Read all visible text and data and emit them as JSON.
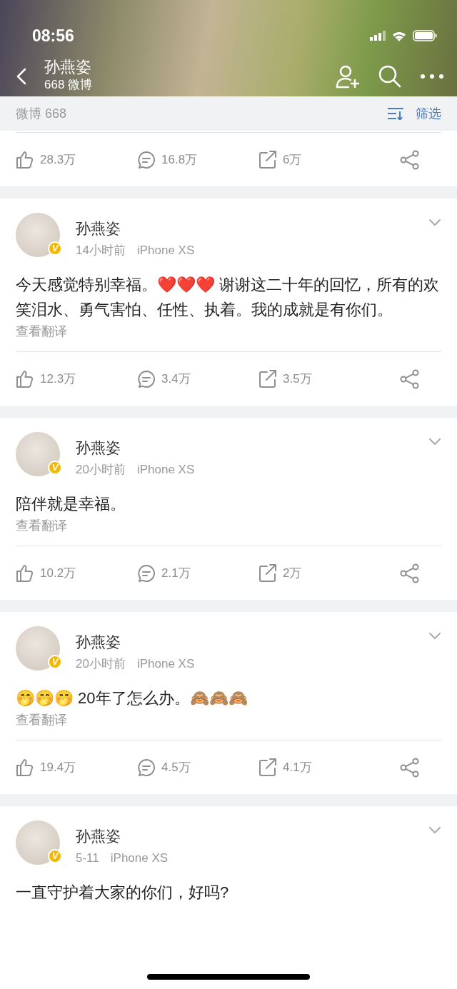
{
  "status_bar": {
    "time": "08:56"
  },
  "header": {
    "title": "孙燕姿",
    "subtitle": "668 微博"
  },
  "filter_bar": {
    "label": "微博 668",
    "filter_label": "筛选"
  },
  "top_card_actions": {
    "likes": "28.3万",
    "comments": "16.8万",
    "reposts": "6万"
  },
  "posts": [
    {
      "author": "孙燕姿",
      "badge": "V",
      "time": "14小时前",
      "device": "iPhone XS",
      "text": "今天感觉特别幸福。❤️❤️❤️ 谢谢这二十年的回忆，所有的欢笑泪水、勇气害怕、任性、执着。我的成就是有你们。",
      "translate": "查看翻译",
      "likes": "12.3万",
      "comments": "3.4万",
      "reposts": "3.5万"
    },
    {
      "author": "孙燕姿",
      "badge": "V",
      "time": "20小时前",
      "device": "iPhone XS",
      "text": "陪伴就是幸福。",
      "translate": "查看翻译",
      "likes": "10.2万",
      "comments": "2.1万",
      "reposts": "2万"
    },
    {
      "author": "孙燕姿",
      "badge": "V",
      "time": "20小时前",
      "device": "iPhone XS",
      "text": "🤭🤭🤭 20年了怎么办。🙈🙈🙈",
      "translate": "查看翻译",
      "likes": "19.4万",
      "comments": "4.5万",
      "reposts": "4.1万"
    },
    {
      "author": "孙燕姿",
      "badge": "V",
      "time": "5-11",
      "device": "iPhone XS",
      "text": "一直守护着大家的你们，好吗?"
    }
  ]
}
